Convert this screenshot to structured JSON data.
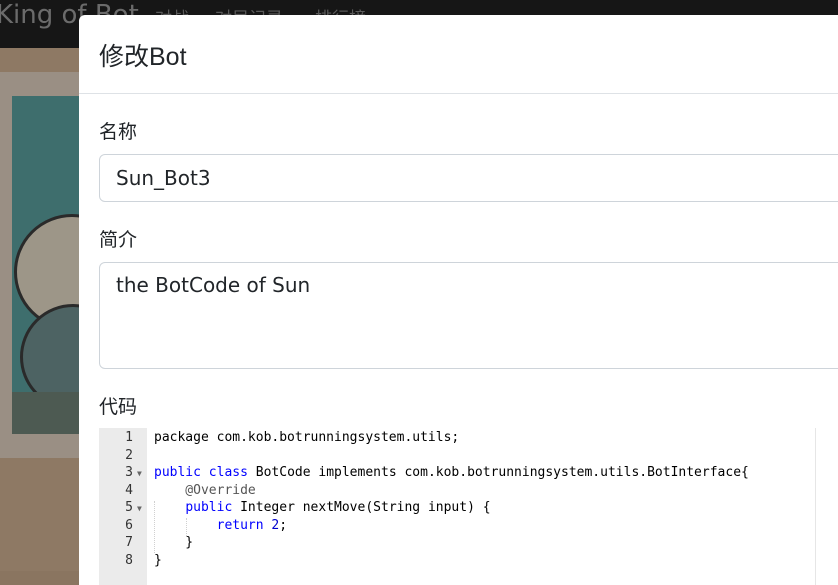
{
  "navbar": {
    "brand": "King of Bot",
    "links": [
      "对战",
      "对局记录",
      "排行榜"
    ]
  },
  "modal": {
    "title": "修改Bot",
    "name_label": "名称",
    "name_value": "Sun_Bot3",
    "desc_label": "简介",
    "desc_value": "the BotCode of Sun",
    "code_label": "代码"
  },
  "code": {
    "l1": "package com.kob.botrunningsystem.utils;",
    "l3_kw1": "public",
    "l3_kw2": "class",
    "l3_rest": " BotCode implements com.kob.botrunningsystem.utils.BotInterface{",
    "l4": "    @Override",
    "l5_kw": "public",
    "l5_rest": " Integer nextMove(String input) {",
    "l6_kw": "return",
    "l6_num": "2",
    "l6_end": ";",
    "l7": "    }",
    "l8": "}",
    "line_numbers": [
      "1",
      "2",
      "3",
      "4",
      "5",
      "6",
      "7",
      "8"
    ]
  }
}
